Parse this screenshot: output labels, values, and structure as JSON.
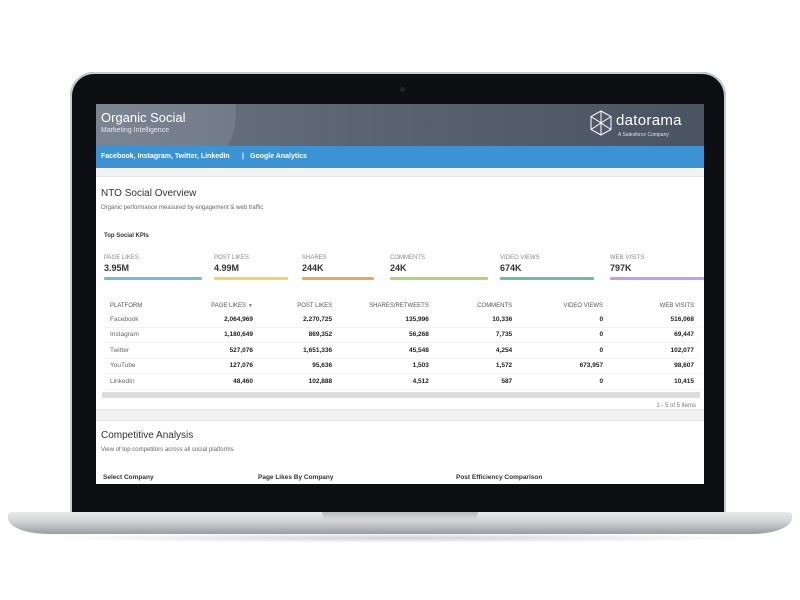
{
  "header": {
    "title": "Organic Social",
    "subtitle": "Marketing Intelligence",
    "brand_name": "datorama",
    "brand_tagline": "A Salesforce Company"
  },
  "filters": {
    "platforms": "Facebook, Instagram, Twitter, LinkedIn",
    "separator": "|",
    "analytics": "Google Analytics"
  },
  "overview": {
    "title": "NTO Social Overview",
    "subtitle": "Organic performance measured by engagement & web traffic",
    "kpi_heading": "Top Social KPIs",
    "kpis": [
      {
        "label": "PAGE LIKES",
        "value": "3.95M",
        "color": "#74b9de"
      },
      {
        "label": "POST LIKES",
        "value": "4.99M",
        "color": "#f3d35a"
      },
      {
        "label": "SHARES",
        "value": "244K",
        "color": "#f0a65a"
      },
      {
        "label": "COMMENTS",
        "value": "24K",
        "color": "#a9d86b"
      },
      {
        "label": "VIDEO VIEWS",
        "value": "674K",
        "color": "#5cc79a"
      },
      {
        "label": "WEB VISITS",
        "value": "797K",
        "color": "#c79be6"
      }
    ],
    "table": {
      "columns": [
        "PLATFORM",
        "PAGE LIKES",
        "POST LIKES",
        "SHARES/RETWEETS",
        "COMMENTS",
        "VIDEO VIEWS",
        "WEB VISITS"
      ],
      "rows": [
        [
          "Facebook",
          "2,064,969",
          "2,270,725",
          "135,996",
          "10,336",
          "0",
          "516,068"
        ],
        [
          "Instagram",
          "1,180,649",
          "869,352",
          "56,268",
          "7,735",
          "0",
          "69,447"
        ],
        [
          "Twitter",
          "527,076",
          "1,651,336",
          "45,548",
          "4,254",
          "0",
          "102,077"
        ],
        [
          "YouTube",
          "127,076",
          "95,636",
          "1,503",
          "1,572",
          "673,957",
          "98,607"
        ],
        [
          "LinkedIn",
          "48,460",
          "102,888",
          "4,512",
          "587",
          "0",
          "10,415"
        ]
      ]
    },
    "pager": "1 - 5 of 5 items"
  },
  "competitive": {
    "title": "Competitive Analysis",
    "subtitle": "View of top competitors across all social platforms",
    "col1": "Select Company",
    "col2": "Page Likes By Company",
    "col3": "Post Efficiency Comparison"
  }
}
